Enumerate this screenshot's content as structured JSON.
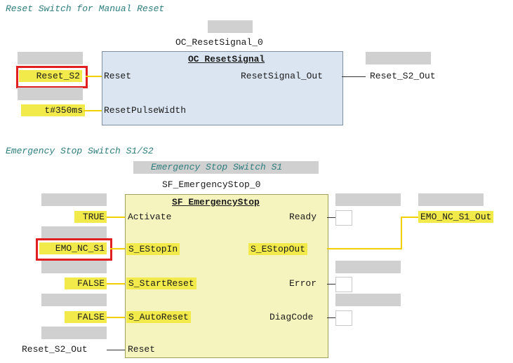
{
  "network1": {
    "comment": "Reset Switch for Manual Reset",
    "instance_name": "OC_ResetSignal_0",
    "block_type": "OC_ResetSignal",
    "inputs": [
      {
        "value": "Reset_S2",
        "pin": "Reset"
      },
      {
        "value": "t#350ms",
        "pin": "ResetPulseWidth"
      }
    ],
    "output_pin": "ResetSignal_Out",
    "output_var": "Reset_S2_Out"
  },
  "network2": {
    "comment": "Emergency Stop Switch S1/S2",
    "block_comment": "Emergency Stop Switch S1",
    "instance_name": "SF_EmergencyStop_0",
    "block_type": "SF_EmergencyStop",
    "inputs": [
      {
        "value": "TRUE",
        "pin": "Activate"
      },
      {
        "value": "EMO_NC_S1",
        "pin": "S_EStopIn"
      },
      {
        "value": "FALSE",
        "pin": "S_StartReset"
      },
      {
        "value": "FALSE",
        "pin": "S_AutoReset"
      },
      {
        "value": "Reset_S2_Out",
        "pin": "Reset"
      }
    ],
    "outputs": [
      {
        "pin": "Ready"
      },
      {
        "pin": "S_EStopOut",
        "var": "EMO_NC_S1_Out"
      },
      {
        "pin": "Error"
      },
      {
        "pin": "DiagCode"
      }
    ]
  },
  "colors": {
    "block_blue": "#dbe5f1",
    "block_yellow": "#f6f4be",
    "highlight_yellow": "#f2ea4a",
    "selection_red": "#e02020",
    "comment_teal": "#2e7d7d"
  }
}
